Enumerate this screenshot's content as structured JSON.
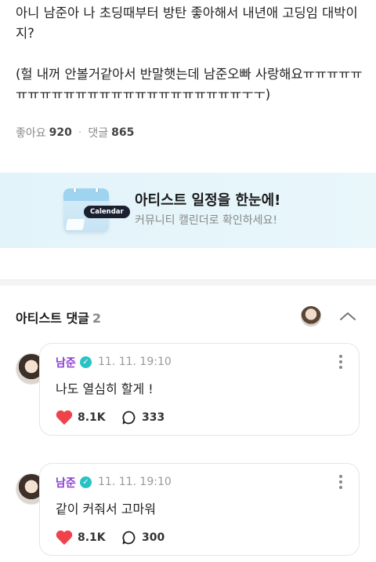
{
  "post": {
    "body": "아니 남준아 나 초딩때부터 방탄 좋아해서 내년애 고딩임 대박이지?\n\n(헐 내꺼 안볼거같아서 반말햇는데 남준오빠 사랑해요ㅠㅠㅠㅠㅠㅠㅠㅠㅠㅠㅠㅠㅠㅠㅠㅠㅠㅠㅠㅠㅠㅠㅠㅠㅜㅜ)",
    "likes_label": "좋아요",
    "likes_count": "920",
    "comments_label": "댓글",
    "comments_count": "865"
  },
  "banner": {
    "icon_label": "Calendar",
    "title": "아티스트 일정을 한눈에!",
    "subtitle": "커뮤니티 캘린더로 확인하세요!"
  },
  "artist_comments": {
    "title": "아티스트 댓글",
    "count": "2",
    "items": [
      {
        "name": "남준",
        "date": "11. 11. 19:10",
        "text": "나도 열심히 할게 !",
        "likes": "8.1K",
        "replies": "333"
      },
      {
        "name": "남준",
        "date": "11. 11. 19:10",
        "text": "같이 커줘서 고마워",
        "likes": "8.1K",
        "replies": "300"
      }
    ]
  },
  "colors": {
    "artist_name": "#8a3ed1",
    "verified_badge": "#27c3c4",
    "heart": "#f0424a",
    "banner_bg": "#e2f3fa"
  }
}
